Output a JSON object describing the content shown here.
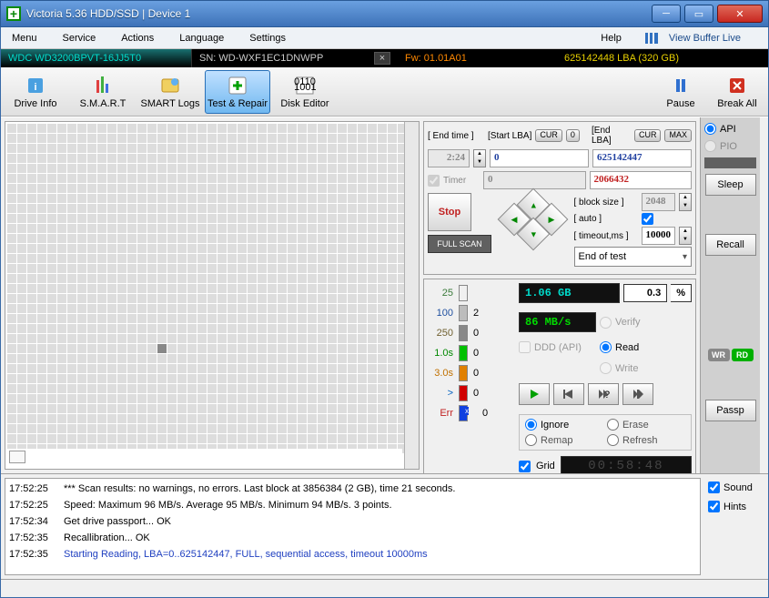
{
  "titlebar": {
    "title": "Victoria 5.36 HDD/SSD | Device 1"
  },
  "menu": {
    "items": [
      "Menu",
      "Service",
      "Actions",
      "Language",
      "Settings"
    ],
    "help": "Help",
    "buffer": "View Buffer Live"
  },
  "strip": {
    "model": "WDC WD3200BPVT-16JJ5T0",
    "sn": "SN: WD-WXF1EC1DNWPP",
    "fw": "Fw: 01.01A01",
    "lba": "625142448 LBA (320 GB)"
  },
  "toolbar": {
    "items": [
      {
        "name": "drive-info",
        "label": "Drive Info"
      },
      {
        "name": "smart",
        "label": "S.M.A.R.T"
      },
      {
        "name": "smart-logs",
        "label": "SMART Logs"
      },
      {
        "name": "test-repair",
        "label": "Test & Repair",
        "sel": true
      },
      {
        "name": "disk-editor",
        "label": "Disk Editor"
      }
    ],
    "pause": "Pause",
    "break": "Break All"
  },
  "scan": {
    "end_time_lbl": "[ End time ]",
    "end_time": "2:24",
    "timer_lbl": "Timer",
    "start_lba_lbl": "[Start LBA]",
    "start_btn_cur": "CUR",
    "start_btn_0": "0",
    "start_lba": "0",
    "end_lba_lbl": "[End LBA]",
    "end_btn_cur": "CUR",
    "end_btn_max": "MAX",
    "end_lba": "625142447",
    "cur_start": "0",
    "cur_pos": "2066432",
    "stop": "Stop",
    "fullscan": "FULL SCAN",
    "block_size_lbl": "[ block size ]",
    "block_size": "2048",
    "auto_lbl": "[ auto ]",
    "timeout_lbl": "[ timeout,ms ]",
    "timeout": "10000",
    "endtest": "End of test",
    "gb": "1.06 GB",
    "pct": "0.3",
    "speed": "86 MB/s",
    "ddd": "DDD (API)",
    "modes": {
      "verify": "Verify",
      "read": "Read",
      "write": "Write"
    },
    "actions": {
      "ignore": "Ignore",
      "erase": "Erase",
      "remap": "Remap",
      "refresh": "Refresh"
    },
    "grid": "Grid",
    "timer_led": "00:58:48",
    "legend": [
      {
        "th": "25",
        "cls": "th25",
        "box": "#f0f0f0",
        "cnt": ""
      },
      {
        "th": "100",
        "cls": "th100",
        "box": "#bcbcbc",
        "cnt": "2"
      },
      {
        "th": "250",
        "cls": "th250",
        "box": "#888888",
        "cnt": "0"
      },
      {
        "th": "1.0s",
        "cls": "th10s",
        "box": "#00c000",
        "cnt": "0"
      },
      {
        "th": "3.0s",
        "cls": "th30s",
        "box": "#e08000",
        "cnt": "0"
      },
      {
        "th": ">",
        "cls": "thgt",
        "box": "#d00000",
        "cnt": "0"
      },
      {
        "th": "Err",
        "cls": "therr",
        "box": "#1040e0",
        "cnt": "0",
        "x": true
      }
    ]
  },
  "side": {
    "api": "API",
    "pio": "PIO",
    "sleep": "Sleep",
    "recall": "Recall",
    "passp": "Passp",
    "wr": "WR",
    "rd": "RD"
  },
  "log": {
    "rows": [
      {
        "t": "17:52:25",
        "m": "*** Scan results: no warnings, no errors. Last block at 3856384 (2 GB), time 21 seconds."
      },
      {
        "t": "17:52:25",
        "m": "Speed: Maximum 96 MB/s. Average 95 MB/s. Minimum 94 MB/s. 3 points."
      },
      {
        "t": "17:52:34",
        "m": "Get drive passport... OK"
      },
      {
        "t": "17:52:35",
        "m": "Recallibration... OK"
      },
      {
        "t": "17:52:35",
        "m": "Starting Reading, LBA=0..625142447, FULL, sequential access, timeout 10000ms",
        "blue": true
      }
    ],
    "sound": "Sound",
    "hints": "Hints"
  }
}
